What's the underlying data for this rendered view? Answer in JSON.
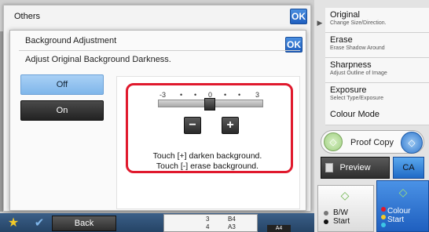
{
  "others_panel": {
    "title": "Others",
    "ok_label": "OK"
  },
  "dialog": {
    "title": "Background Adjustment",
    "ok_label": "OK",
    "subtitle": "Adjust Original Background Darkness.",
    "options": {
      "off_label": "Off",
      "on_label": "On",
      "selected": "Off"
    },
    "slider": {
      "min_label": "-3",
      "mid_label": "0",
      "max_label": "3",
      "value": 0
    },
    "minus_label": "−",
    "plus_label": "+",
    "hint_line1": "Touch [+] darken background.",
    "hint_line2": "Touch [-] erase background."
  },
  "bottom_bar": {
    "back_label": "Back",
    "tray": {
      "r1c1": "3",
      "r1c2": "B4",
      "r2c1": "4",
      "r2c2": "A3",
      "paper": "A4"
    }
  },
  "sidebar": {
    "items": [
      {
        "label": "Original",
        "sub": "Change Size/Direction."
      },
      {
        "label": "Erase",
        "sub": "Erase Shadow Around"
      },
      {
        "label": "Sharpness",
        "sub": "Adjust Outline of Image"
      },
      {
        "label": "Exposure",
        "sub": "Select Type/Exposure"
      }
    ],
    "colour_mode_label": "Colour Mode",
    "proof_copy_label": "Proof Copy",
    "preview_label": "Preview",
    "ca_label": "CA",
    "bw_start_line1": "B/W",
    "bw_start_line2": "Start",
    "colour_start_line1": "Colour",
    "colour_start_line2": "Start"
  },
  "colors": {
    "accent": "#1f5fbf",
    "highlight": "#e0192d",
    "selected_option": "#7fb6ea"
  }
}
